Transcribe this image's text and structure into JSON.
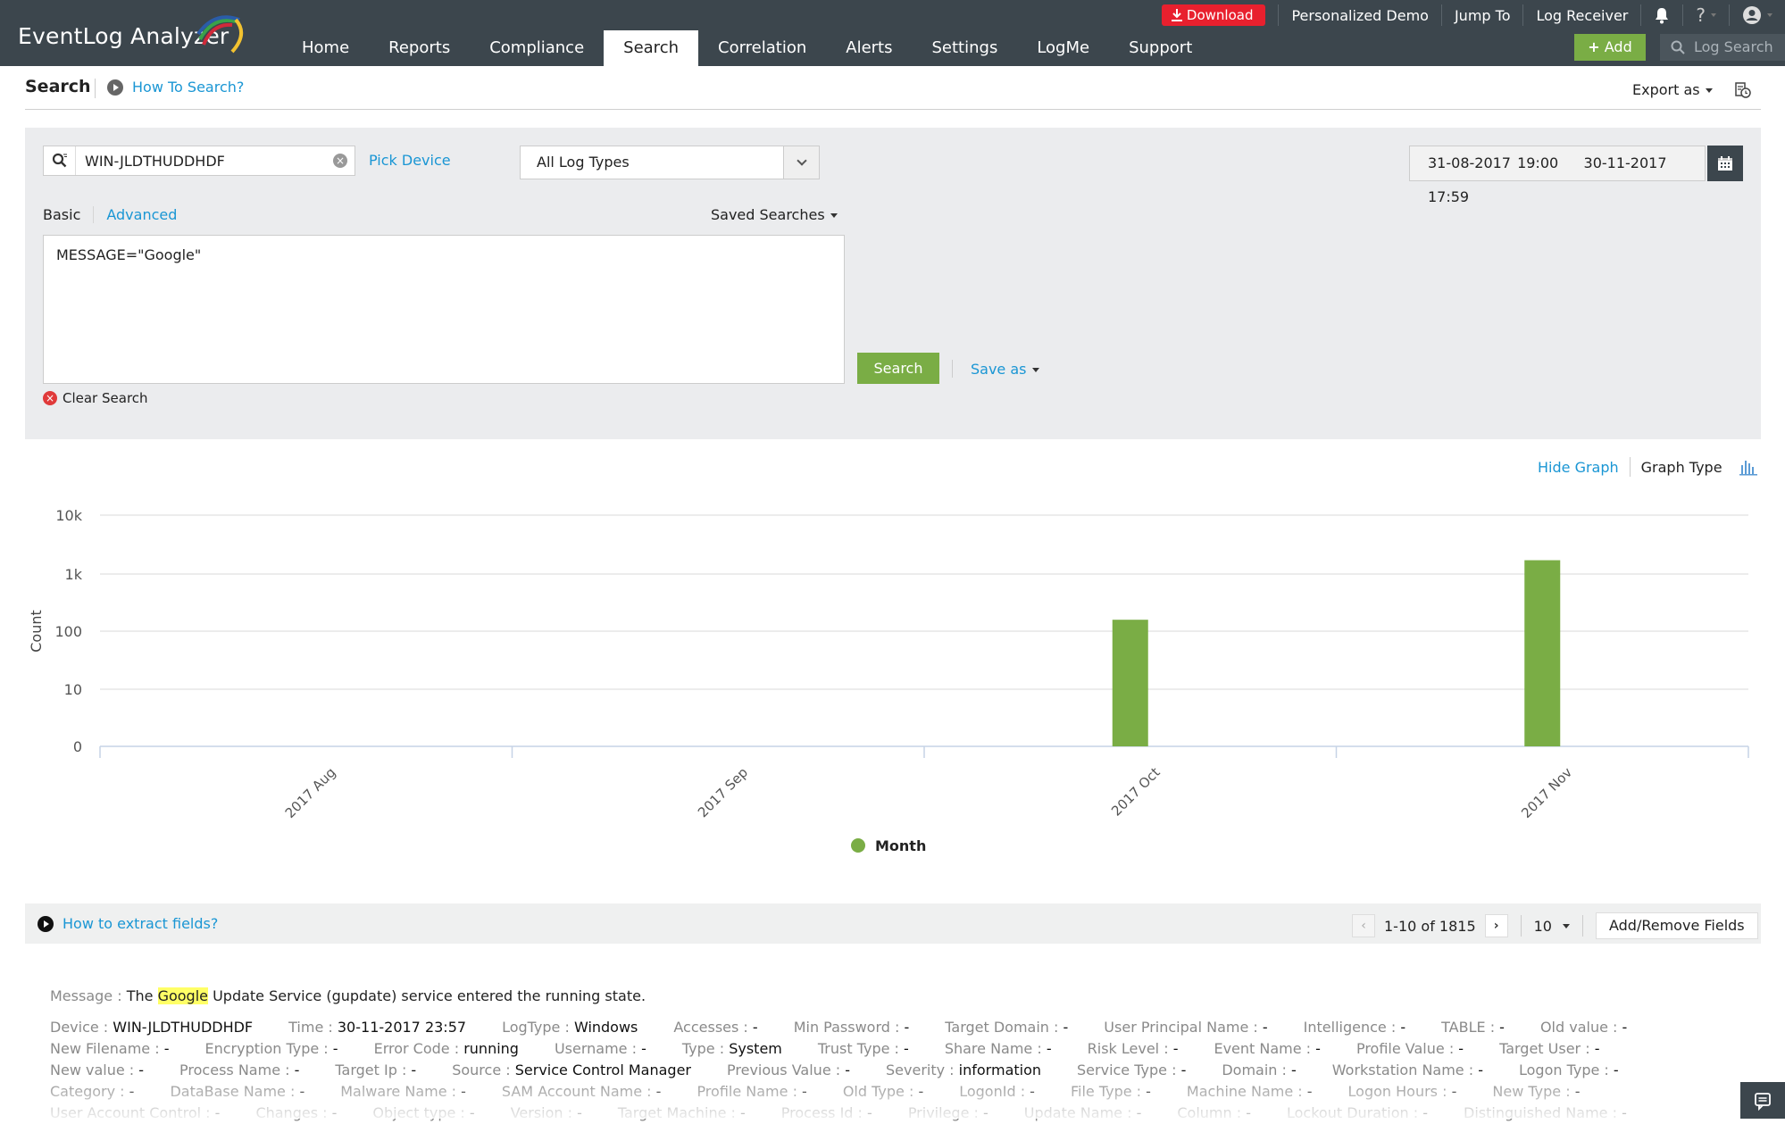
{
  "app": {
    "title": "EventLog Analyzer"
  },
  "topbar": {
    "nav": [
      {
        "label": "Home",
        "active": false
      },
      {
        "label": "Reports",
        "active": false
      },
      {
        "label": "Compliance",
        "active": false
      },
      {
        "label": "Search",
        "active": true
      },
      {
        "label": "Correlation",
        "active": false
      },
      {
        "label": "Alerts",
        "active": false
      },
      {
        "label": "Settings",
        "active": false
      },
      {
        "label": "LogMe",
        "active": false
      },
      {
        "label": "Support",
        "active": false
      }
    ],
    "download_label": "Download",
    "personalized_demo": "Personalized Demo",
    "jump_to": "Jump To",
    "log_receiver": "Log Receiver",
    "help_label": "?",
    "add_label": "Add",
    "log_search_placeholder": "Log Search",
    "icons": {
      "download": "download-icon",
      "bell": "bell-icon",
      "help": "question-icon",
      "user": "user-avatar-icon",
      "plus": "plus-icon",
      "search": "search-icon"
    },
    "colors": {
      "bar": "#3c464d",
      "download": "#e8202e",
      "add": "#7aad45"
    }
  },
  "page": {
    "title": "Search",
    "how_to": "How To Search?",
    "export_label": "Export as"
  },
  "search": {
    "device_value": "WIN-JLDTHUDDHDF",
    "pick_device": "Pick Device",
    "log_type": "All Log Types",
    "date_from": "31-08-2017 19:00",
    "date_to": "30-11-2017 17:59",
    "tabs": [
      {
        "label": "Basic",
        "active": true
      },
      {
        "label": "Advanced",
        "active": false
      }
    ],
    "saved_searches": "Saved Searches",
    "query": "MESSAGE=\"Google\"",
    "search_button": "Search",
    "save_as": "Save as",
    "clear_search": "Clear Search"
  },
  "graph": {
    "hide_graph": "Hide Graph",
    "graph_type": "Graph Type"
  },
  "chart_data": {
    "type": "bar",
    "title": "",
    "xlabel": "",
    "ylabel": "Count",
    "yscale": "log",
    "yticks": [
      "0",
      "10",
      "100",
      "1k",
      "10k"
    ],
    "ylim": [
      1,
      10000
    ],
    "categories": [
      "2017 Aug",
      "2017 Sep",
      "2017 Oct",
      "2017 Nov"
    ],
    "series": [
      {
        "name": "Month",
        "color": "#7aad45",
        "values": [
          0,
          0,
          155,
          1660
        ]
      }
    ],
    "legend": {
      "position": "bottom-center",
      "entries": [
        "Month"
      ]
    },
    "grid": true
  },
  "results": {
    "extract_help": "How to extract fields?",
    "range_text": "1-10 of 1815",
    "per_page": "10",
    "add_remove_fields": "Add/Remove Fields"
  },
  "record": {
    "message_label": "Message :",
    "message_before": "The",
    "message_highlight": "Google",
    "message_after": "Update Service (gupdate) service entered the running state.",
    "rows": [
      [
        {
          "label": "Device :",
          "value": "WIN-JLDTHUDDHDF"
        },
        {
          "label": "Time :",
          "value": "30-11-2017 23:57"
        },
        {
          "label": "LogType :",
          "value": "Windows"
        },
        {
          "label": "Accesses :",
          "value": "-"
        },
        {
          "label": "Min Password :",
          "value": "-"
        },
        {
          "label": "Target Domain :",
          "value": "-"
        },
        {
          "label": "User Principal Name :",
          "value": "-"
        },
        {
          "label": "Intelligence :",
          "value": "-"
        },
        {
          "label": "TABLE :",
          "value": "-"
        },
        {
          "label": "Old value :",
          "value": "-"
        }
      ],
      [
        {
          "label": "New Filename :",
          "value": "-"
        },
        {
          "label": "Encryption Type :",
          "value": "-"
        },
        {
          "label": "Error Code :",
          "value": "running"
        },
        {
          "label": "Username :",
          "value": "-"
        },
        {
          "label": "Type :",
          "value": "System"
        },
        {
          "label": "Trust Type :",
          "value": "-"
        },
        {
          "label": "Share Name :",
          "value": "-"
        },
        {
          "label": "Risk Level :",
          "value": "-"
        },
        {
          "label": "Event Name :",
          "value": "-"
        },
        {
          "label": "Profile Value :",
          "value": "-"
        },
        {
          "label": "Target User :",
          "value": "-"
        }
      ],
      [
        {
          "label": "New value :",
          "value": "-"
        },
        {
          "label": "Process Name :",
          "value": "-"
        },
        {
          "label": "Target Ip :",
          "value": "-"
        },
        {
          "label": "Source :",
          "value": "Service Control Manager"
        },
        {
          "label": "Previous Value :",
          "value": "-"
        },
        {
          "label": "Severity :",
          "value": "information"
        },
        {
          "label": "Service Type :",
          "value": "-"
        },
        {
          "label": "Domain :",
          "value": "-"
        },
        {
          "label": "Workstation Name :",
          "value": "-"
        },
        {
          "label": "Logon Type :",
          "value": "-"
        }
      ],
      [
        {
          "label": "Category :",
          "value": "-"
        },
        {
          "label": "DataBase Name :",
          "value": "-"
        },
        {
          "label": "Malware Name :",
          "value": "-"
        },
        {
          "label": "SAM Account Name :",
          "value": "-"
        },
        {
          "label": "Profile Name :",
          "value": "-"
        },
        {
          "label": "Old Type :",
          "value": "-"
        },
        {
          "label": "LogonId :",
          "value": "-"
        },
        {
          "label": "File Type :",
          "value": "-"
        },
        {
          "label": "Machine Name :",
          "value": "-"
        },
        {
          "label": "Logon Hours :",
          "value": "-"
        },
        {
          "label": "New Type :",
          "value": "-"
        }
      ],
      [
        {
          "label": "User Account Control :",
          "value": "-"
        },
        {
          "label": "Changes :",
          "value": "-"
        },
        {
          "label": "Object type :",
          "value": "-"
        },
        {
          "label": "Version :",
          "value": "-"
        },
        {
          "label": "Target Machine :",
          "value": "-"
        },
        {
          "label": "Process Id :",
          "value": "-"
        },
        {
          "label": "Privilege :",
          "value": "-"
        },
        {
          "label": "Update Name :",
          "value": "-"
        },
        {
          "label": "Column :",
          "value": "-"
        },
        {
          "label": "Lockout Duration :",
          "value": "-"
        },
        {
          "label": "Distinguished Name :",
          "value": "-"
        }
      ]
    ]
  }
}
